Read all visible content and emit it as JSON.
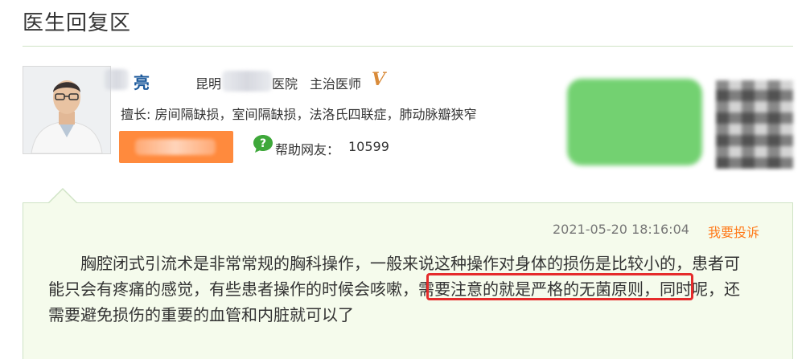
{
  "section": {
    "title": "医生回复区"
  },
  "doctor": {
    "name": "亮",
    "hospital_prefix": "昆明",
    "hospital_suffix": "医院",
    "title": "主治医师",
    "badge": "V",
    "specialty": "擅长: 房间隔缺损，室间隔缺损，法洛氏四联症，肺动脉瓣狭窄",
    "help_label": "帮助网友：",
    "help_count": "10599"
  },
  "reply": {
    "timestamp": "2021-05-20 18:16:04",
    "complain_label": "我要投诉",
    "lines": [
      "　　胸腔闭式引流术是非常常规的胸科操作，一般来说这种操作对身体的损伤是比较小的，患者可",
      "能只会有疼痛的感觉，有些患者操作的时候会咳嗽，需要注意的就是严格的无菌原则，同时呢，还",
      "需要避免损伤的重要的血管和内脏就可以了"
    ]
  },
  "colors": {
    "name_blue": "#1d5a9c",
    "accent_orange": "#ff7a1a",
    "reply_bg": "#f5fbec",
    "highlight_red": "#e52b2b"
  },
  "icons": {
    "badge": "v-badge-icon",
    "help": "chat-bubble-question-icon"
  }
}
